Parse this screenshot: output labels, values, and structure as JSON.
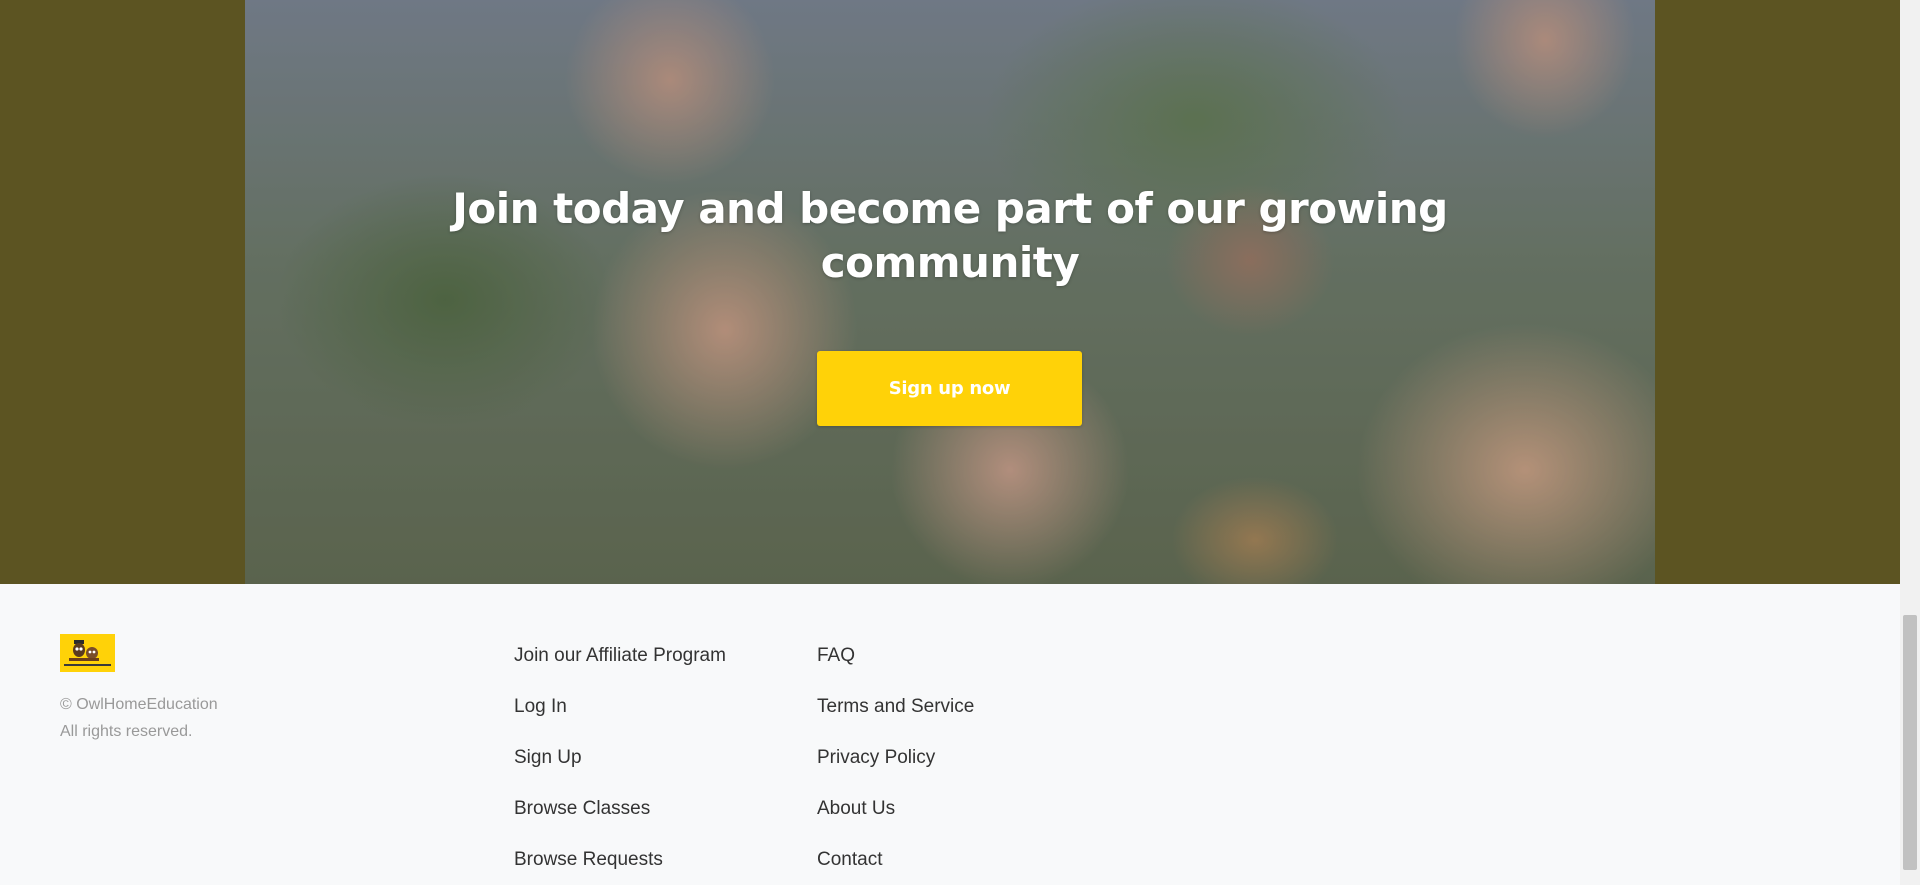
{
  "cta": {
    "title_line1": "Join today and become part of our growing",
    "title_line2": "community",
    "button_label": "Sign up now",
    "button_color": "#ffd208",
    "background_color": "#5c5422"
  },
  "footer": {
    "logo_icon": "owl-home-education-logo",
    "copyright_line1": "© OwlHomeEducation",
    "copyright_line2": "All rights reserved.",
    "links_col1": [
      {
        "label": "Join our Affiliate Program"
      },
      {
        "label": "Log In"
      },
      {
        "label": "Sign Up"
      },
      {
        "label": "Browse Classes"
      },
      {
        "label": "Browse Requests"
      }
    ],
    "links_col2": [
      {
        "label": "FAQ"
      },
      {
        "label": "Terms and Service"
      },
      {
        "label": "Privacy Policy"
      },
      {
        "label": "About Us"
      },
      {
        "label": "Contact"
      }
    ]
  }
}
